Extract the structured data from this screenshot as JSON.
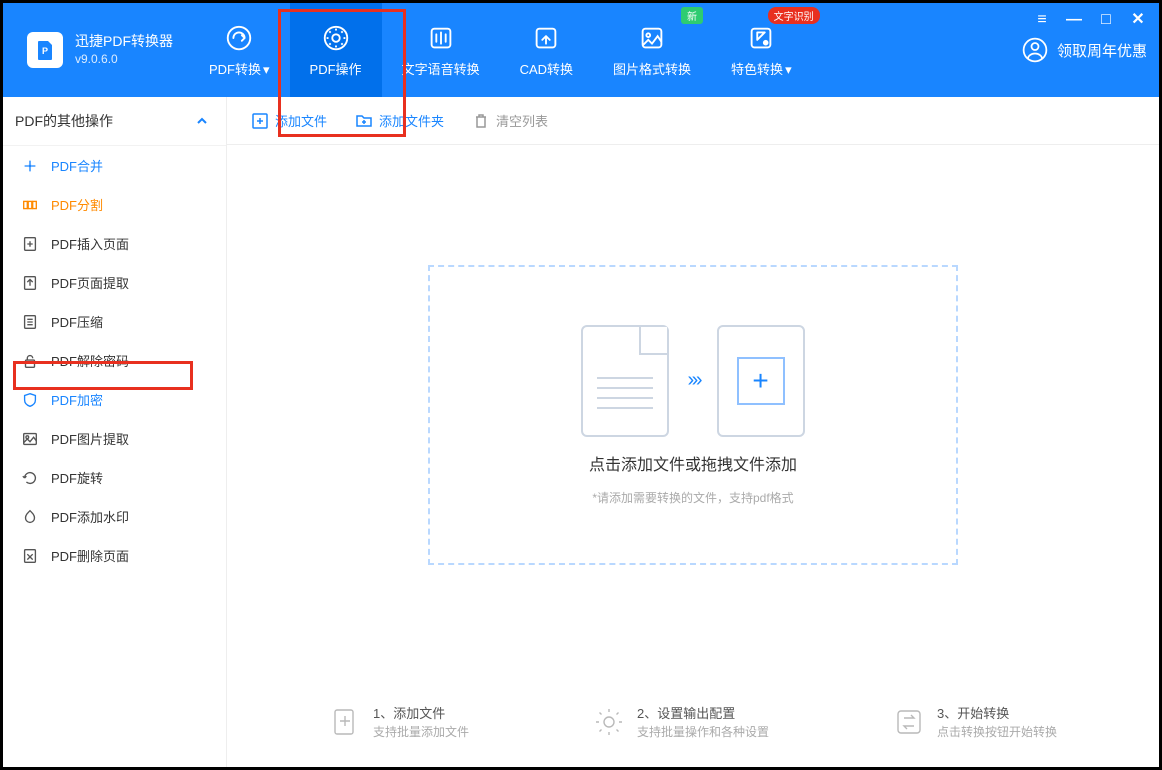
{
  "app": {
    "title": "迅捷PDF转换器",
    "version": "v9.0.6.0"
  },
  "nav": [
    {
      "label": "PDF转换",
      "id": "pdf-convert",
      "badge": null,
      "chev": true
    },
    {
      "label": "PDF操作",
      "id": "pdf-operate",
      "badge": null,
      "chev": false,
      "active": true
    },
    {
      "label": "文字语音转换",
      "id": "tts",
      "badge": null,
      "chev": false
    },
    {
      "label": "CAD转换",
      "id": "cad",
      "badge": null,
      "chev": false
    },
    {
      "label": "图片格式转换",
      "id": "image",
      "badge": "新",
      "chev": false
    },
    {
      "label": "特色转换",
      "id": "special",
      "badge": "文字识别",
      "chev": true
    }
  ],
  "promo": "领取周年优惠",
  "sidebar": {
    "header": "PDF的其他操作",
    "items": [
      {
        "label": "PDF合并",
        "accent": "blue"
      },
      {
        "label": "PDF分割",
        "accent": "orange"
      },
      {
        "label": "PDF插入页面"
      },
      {
        "label": "PDF页面提取"
      },
      {
        "label": "PDF压缩"
      },
      {
        "label": "PDF解除密码"
      },
      {
        "label": "PDF加密",
        "accent": "blue"
      },
      {
        "label": "PDF图片提取"
      },
      {
        "label": "PDF旋转"
      },
      {
        "label": "PDF添加水印"
      },
      {
        "label": "PDF删除页面"
      }
    ]
  },
  "toolbar": {
    "add_file": "添加文件",
    "add_folder": "添加文件夹",
    "clear_list": "清空列表"
  },
  "dropzone": {
    "title": "点击添加文件或拖拽文件添加",
    "subtitle": "*请添加需要转换的文件，支持pdf格式"
  },
  "steps": [
    {
      "title": "1、添加文件",
      "sub": "支持批量添加文件"
    },
    {
      "title": "2、设置输出配置",
      "sub": "支持批量操作和各种设置"
    },
    {
      "title": "3、开始转换",
      "sub": "点击转换按钮开始转换"
    }
  ]
}
